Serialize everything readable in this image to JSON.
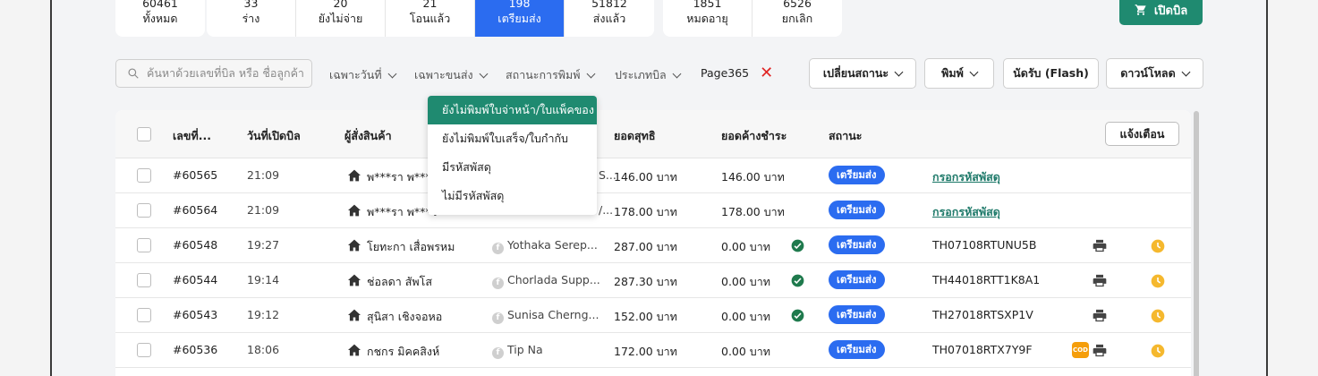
{
  "stats_left": [
    {
      "count": "60461",
      "label": "ทั้งหมด"
    }
  ],
  "stats_mid": [
    {
      "count": "33",
      "label": "ร่าง"
    },
    {
      "count": "20",
      "label": "ยังไม่จ่าย"
    },
    {
      "count": "21",
      "label": "โอนแล้ว"
    },
    {
      "count": "198",
      "label": "เตรียมส่ง"
    },
    {
      "count": "51812",
      "label": "ส่งแล้ว"
    }
  ],
  "stats_right": [
    {
      "count": "1851",
      "label": "หมดอายุ"
    },
    {
      "count": "6526",
      "label": "ยกเลิก"
    }
  ],
  "open_bill_label": "เปิดบิล",
  "search_placeholder": "ค้นหาด้วยเลขที่บิล หรือ ชื่อลูกค้า",
  "filters": {
    "date": "เฉพาะวันที่",
    "shipping": "เฉพาะขนส่ง",
    "print_status": "สถานะการพิมพ์",
    "bill_type": "ประเภทบิล",
    "page": "Page365",
    "clear": "✕"
  },
  "actions": {
    "change_status": "เปลี่ยนสถานะ",
    "print": "พิมพ์",
    "pickup": "นัดรับ (Flash)",
    "download": "ดาวน์โหลด"
  },
  "dropdown_items": [
    "ยังไม่พิมพ์ใบจ่าหน้า/ใบแพ็คของ",
    "ยังไม่พิมพ์ใบเสร็จ/ใบกำกับ",
    "มีรหัสพัสดุ",
    "ไม่มีรหัสพัสดุ"
  ],
  "table": {
    "headers": {
      "bill_no": "เลขที่...",
      "date": "วันที่เปิดบิล",
      "customer": "ผู้สั่งสินค้า",
      "net": "ยอดสุทธิ",
      "outstanding": "ยอดค้างชำระ",
      "status": "สถานะ"
    },
    "alert_label": "แจ้งเตือน",
    "rows": [
      {
        "id": "#60565",
        "time": "21:09",
        "customer": "พ***รา พ***ว",
        "source": "S...",
        "net": "146.00 บาท",
        "outstanding": "146.00 บาท",
        "paid": false,
        "status": "เตรียมส่ง",
        "tracking": "กรอกรหัสพัสดุ",
        "tracking_link": true,
        "cod": false,
        "print": false,
        "clock": false
      },
      {
        "id": "#60564",
        "time": "21:09",
        "customer": "พ***รา พ***ว",
        "source": "/...",
        "net": "178.00 บาท",
        "outstanding": "178.00 บาท",
        "paid": false,
        "status": "เตรียมส่ง",
        "tracking": "กรอกรหัสพัสดุ",
        "tracking_link": true,
        "cod": false,
        "print": false,
        "clock": false
      },
      {
        "id": "#60548",
        "time": "19:27",
        "customer": "โยทะกา เสื่อพรหม",
        "source": "Yothaka Serep...",
        "net": "287.00 บาท",
        "outstanding": "0.00 บาท",
        "paid": true,
        "status": "เตรียมส่ง",
        "tracking": "TH07108RTUNU5B",
        "tracking_link": false,
        "cod": false,
        "print": true,
        "clock": true
      },
      {
        "id": "#60544",
        "time": "19:14",
        "customer": "ช่อลดา สัพโส",
        "source": "Chorlada Supp...",
        "net": "287.30 บาท",
        "outstanding": "0.00 บาท",
        "paid": true,
        "status": "เตรียมส่ง",
        "tracking": "TH44018RTT1K8A1",
        "tracking_link": false,
        "cod": false,
        "print": true,
        "clock": true
      },
      {
        "id": "#60543",
        "time": "19:12",
        "customer": "สุนิสา เชิงจอหอ",
        "source": "Sunisa Cherng...",
        "net": "152.00 บาท",
        "outstanding": "0.00 บาท",
        "paid": true,
        "status": "เตรียมส่ง",
        "tracking": "TH27018RTSXP1V",
        "tracking_link": false,
        "cod": false,
        "print": true,
        "clock": true
      },
      {
        "id": "#60536",
        "time": "18:06",
        "customer": "กชกร มิคคสิงห์",
        "source": "Tip Na",
        "net": "172.00 บาท",
        "outstanding": "0.00 บาท",
        "paid": false,
        "status": "เตรียมส่ง",
        "tracking": "TH07018RTX7Y9F",
        "tracking_link": false,
        "cod": true,
        "cod_label": "COD",
        "print": true,
        "clock": true
      }
    ]
  },
  "colors": {
    "accent_green": "#1f8a70",
    "active_blue": "#2b6cf0",
    "clock_yellow": "#f5b82e",
    "paid_green": "#1f7a4d",
    "clear_red": "#e02424"
  }
}
